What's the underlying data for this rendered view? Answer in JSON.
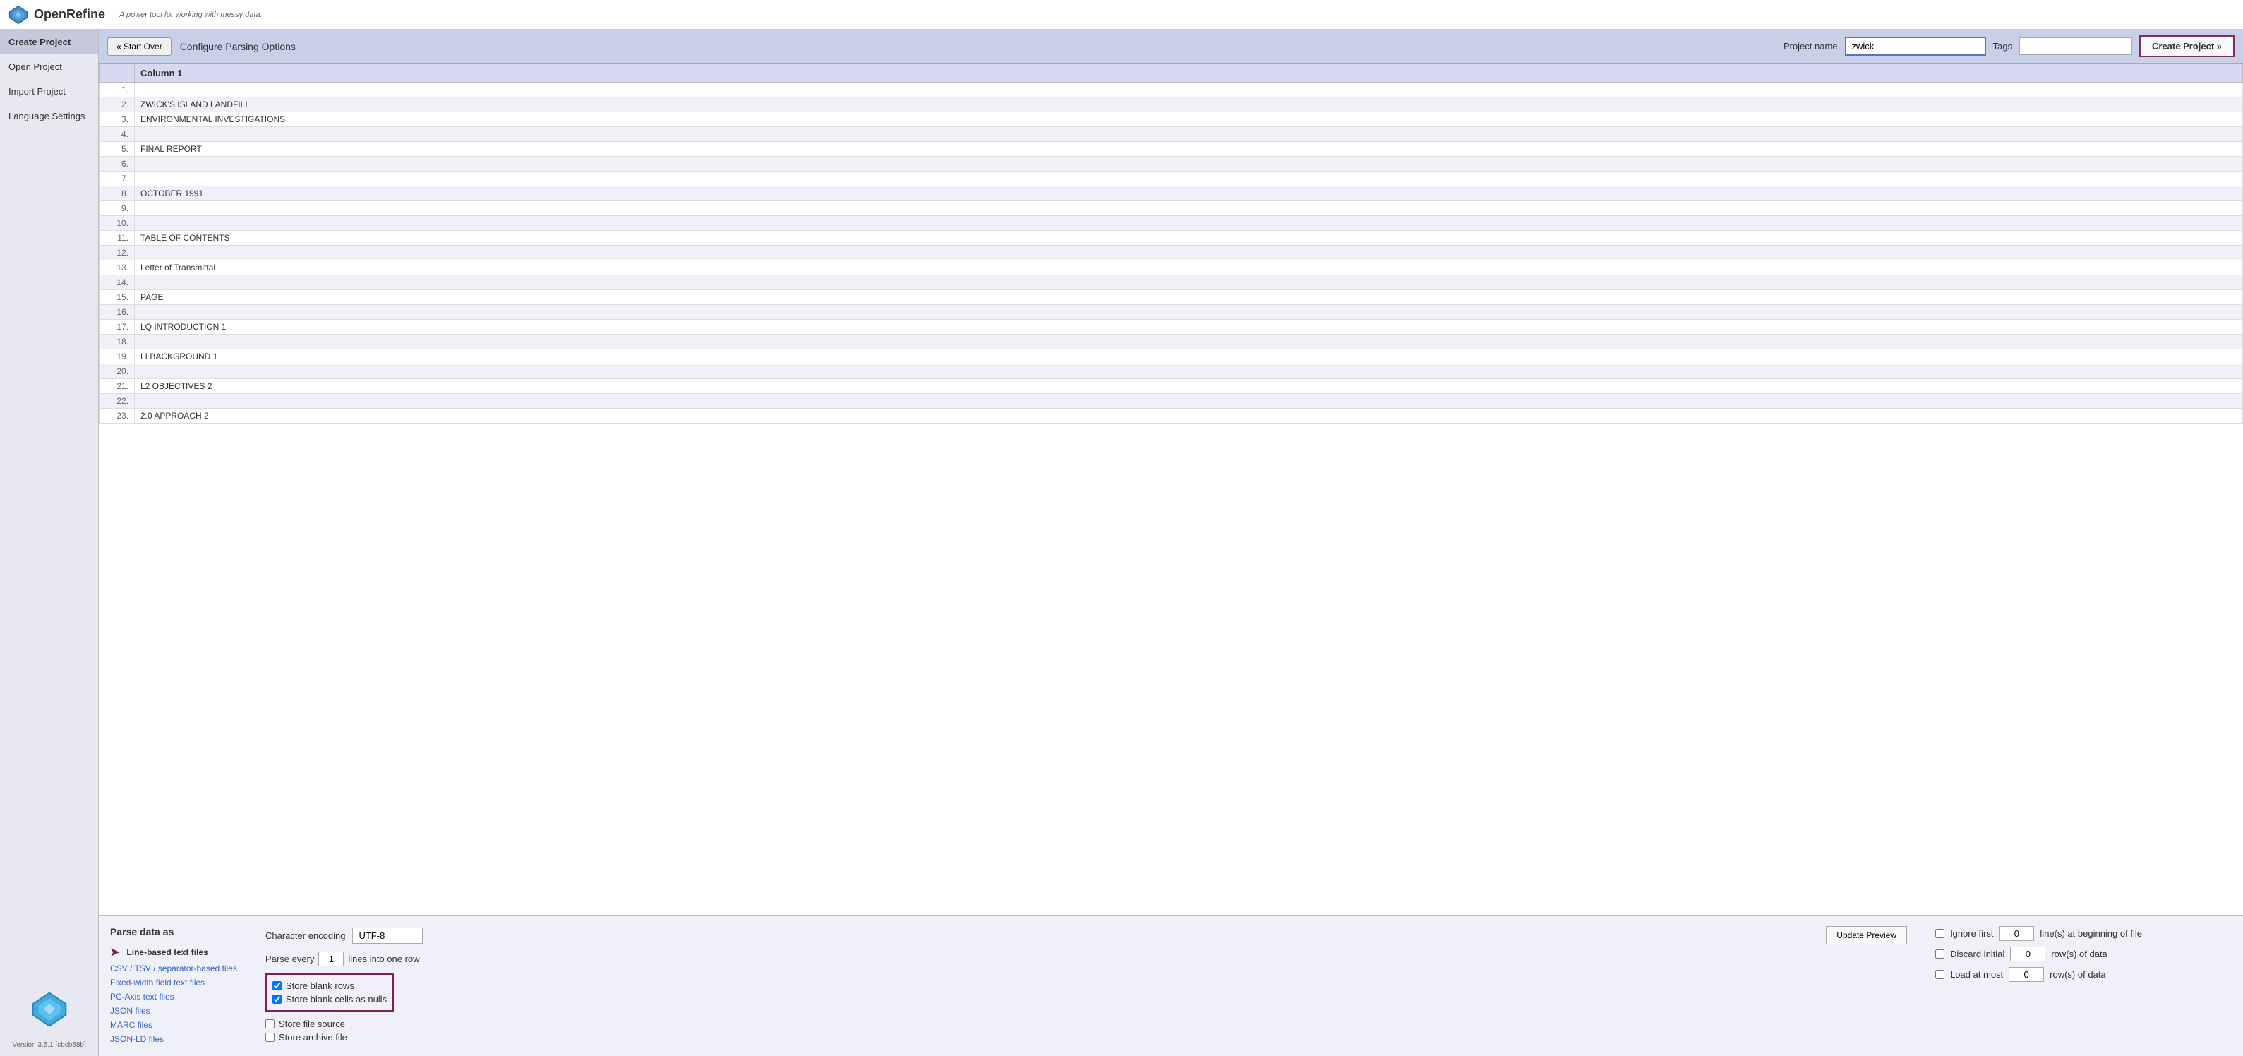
{
  "header": {
    "logo_text": "OpenRefine",
    "tagline": "A power tool for working with messy data."
  },
  "sidebar": {
    "items": [
      {
        "id": "create-project",
        "label": "Create Project",
        "active": true
      },
      {
        "id": "open-project",
        "label": "Open Project",
        "active": false
      },
      {
        "id": "import-project",
        "label": "Import Project",
        "active": false
      },
      {
        "id": "language-settings",
        "label": "Language Settings",
        "active": false
      }
    ],
    "version": "Version 3.5.1 [cbcb58b]"
  },
  "toolbar": {
    "start_over_label": "« Start Over",
    "configure_label": "Configure Parsing Options",
    "project_name_label": "Project name",
    "project_name_value": "zwick",
    "tags_label": "Tags",
    "tags_value": "",
    "create_project_label": "Create Project »"
  },
  "preview": {
    "column_header": "Column 1",
    "rows": [
      {
        "num": "1.",
        "value": ""
      },
      {
        "num": "2.",
        "value": "ZWICK'S ISLAND LANDFILL"
      },
      {
        "num": "3.",
        "value": "ENVIRONMENTAL INVESTIGATIONS"
      },
      {
        "num": "4.",
        "value": ""
      },
      {
        "num": "5.",
        "value": "FINAL REPORT"
      },
      {
        "num": "6.",
        "value": ""
      },
      {
        "num": "7.",
        "value": ""
      },
      {
        "num": "8.",
        "value": "OCTOBER 1991"
      },
      {
        "num": "9.",
        "value": ""
      },
      {
        "num": "10.",
        "value": ""
      },
      {
        "num": "11.",
        "value": "TABLE OF CONTENTS"
      },
      {
        "num": "12.",
        "value": ""
      },
      {
        "num": "13.",
        "value": "Letter of Transmittal"
      },
      {
        "num": "14.",
        "value": ""
      },
      {
        "num": "15.",
        "value": "PAGE"
      },
      {
        "num": "16.",
        "value": ""
      },
      {
        "num": "17.",
        "value": "LQ INTRODUCTION 1"
      },
      {
        "num": "18.",
        "value": ""
      },
      {
        "num": "19.",
        "value": "LI BACKGROUND 1"
      },
      {
        "num": "20.",
        "value": ""
      },
      {
        "num": "21.",
        "value": "L2 OBJECTIVES 2"
      },
      {
        "num": "22.",
        "value": ""
      },
      {
        "num": "23.",
        "value": "2.0 APPROACH 2"
      }
    ]
  },
  "bottom": {
    "parse_as_title": "Parse data as",
    "parse_options": [
      {
        "id": "line-based",
        "label": "Line-based text files",
        "active": true,
        "is_link": false
      },
      {
        "id": "csv-tsv",
        "label": "CSV / TSV / separator-based files",
        "active": false,
        "is_link": true
      },
      {
        "id": "fixed-width",
        "label": "Fixed-width field text files",
        "active": false,
        "is_link": true
      },
      {
        "id": "pc-axis",
        "label": "PC-Axis text files",
        "active": false,
        "is_link": true
      },
      {
        "id": "json",
        "label": "JSON files",
        "active": false,
        "is_link": true
      },
      {
        "id": "marc",
        "label": "MARC files",
        "active": false,
        "is_link": true
      },
      {
        "id": "json-ld",
        "label": "JSON-LD files",
        "active": false,
        "is_link": true
      }
    ],
    "config": {
      "char_encoding_label": "Character encoding",
      "char_encoding_value": "UTF-8",
      "parse_every_label_pre": "Parse every",
      "parse_every_num": "1",
      "parse_every_label_post": "lines into one row",
      "store_blank_rows_label": "Store blank rows",
      "store_blank_rows_checked": true,
      "store_blank_cells_label": "Store blank cells as nulls",
      "store_blank_cells_checked": true,
      "store_file_source_label": "Store file source",
      "store_file_source_checked": false,
      "store_archive_label": "Store archive file",
      "store_archive_checked": false,
      "update_preview_label": "Update Preview"
    },
    "right_options": {
      "ignore_first_label": "Ignore first",
      "ignore_first_num": "0",
      "ignore_first_suffix": "line(s) at beginning of file",
      "discard_initial_label": "Discard initial",
      "discard_initial_num": "0",
      "discard_initial_suffix": "row(s) of data",
      "load_at_most_label": "Load at most",
      "load_at_most_num": "0",
      "load_at_most_suffix": "row(s) of data"
    }
  }
}
